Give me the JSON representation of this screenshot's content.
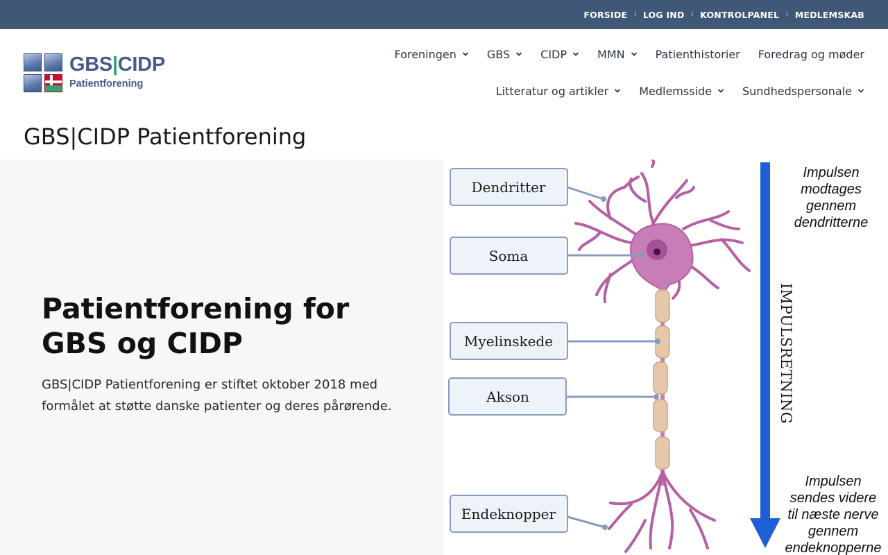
{
  "topbar": {
    "links": [
      "FORSIDE",
      "LOG IND",
      "KONTROLPANEL",
      "MEDLEMSKAB"
    ],
    "separator": "I"
  },
  "logo": {
    "name_left": "GBS",
    "name_bar": "|",
    "name_right": "CIDP",
    "subtitle": "Patientforening"
  },
  "nav": {
    "row1": [
      {
        "label": "Foreningen",
        "dropdown": true
      },
      {
        "label": "GBS",
        "dropdown": true
      },
      {
        "label": "CIDP",
        "dropdown": true
      },
      {
        "label": "MMN",
        "dropdown": true
      },
      {
        "label": "Patienthistorier",
        "dropdown": false
      },
      {
        "label": "Foredrag og møder",
        "dropdown": false
      }
    ],
    "row2": [
      {
        "label": "Litteratur og artikler",
        "dropdown": true
      },
      {
        "label": "Medlemsside",
        "dropdown": true
      },
      {
        "label": "Sundhedspersonale",
        "dropdown": true
      }
    ]
  },
  "page_title": "GBS|CIDP Patientforening",
  "hero": {
    "heading": "Patientforening for GBS og CIDP",
    "text": "GBS|CIDP Patientforening er stiftet oktober 2018 med formålet at støtte danske patienter og deres pårørende."
  },
  "diagram": {
    "labels": [
      "Dendritter",
      "Soma",
      "Myelinskede",
      "Akson",
      "Endeknopper"
    ],
    "top_note": [
      "Impulsen",
      "modtages",
      "gennem",
      "dendritterne"
    ],
    "direction": "IMPULSRETNING",
    "bottom_note": [
      "Impulsen",
      "sendes videre",
      "til næste nerve",
      "gennem",
      "endeknopperne"
    ]
  },
  "colors": {
    "topbar": "#3f5878",
    "brand": "#465a8c",
    "accent_green": "#2aa275",
    "neuron": "#c77db5",
    "arrow": "#1f5fd6",
    "hero_bg": "#f7f7f9"
  }
}
